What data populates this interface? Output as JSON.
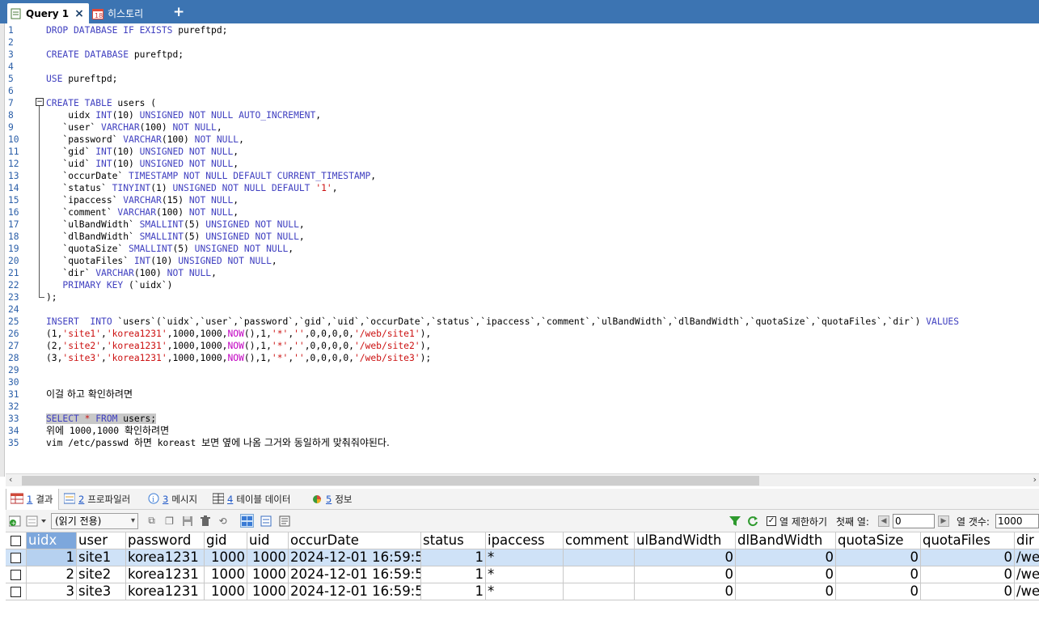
{
  "tabs": [
    {
      "label": "Query 1",
      "close": "×"
    },
    {
      "label": "히스토리"
    }
  ],
  "new_tab": "+",
  "editor": {
    "lines": [
      {
        "n": "1",
        "html": "<span class=\"kw\">DROP DATABASE IF EXISTS</span> pureftpd;"
      },
      {
        "n": "2",
        "html": ""
      },
      {
        "n": "3",
        "html": "<span class=\"kw\">CREATE DATABASE</span> pureftpd;"
      },
      {
        "n": "4",
        "html": ""
      },
      {
        "n": "5",
        "html": "<span class=\"kw\">USE</span> pureftpd;"
      },
      {
        "n": "6",
        "html": ""
      },
      {
        "n": "7",
        "html": "<span class=\"kw\">CREATE TABLE</span> users ("
      },
      {
        "n": "8",
        "html": "    uidx <span class=\"kw\">INT</span>(10) <span class=\"kw\">UNSIGNED NOT NULL AUTO_INCREMENT</span>,"
      },
      {
        "n": "9",
        "html": "   `user` <span class=\"kw\">VARCHAR</span>(100) <span class=\"kw\">NOT NULL</span>,"
      },
      {
        "n": "10",
        "html": "   `password` <span class=\"kw\">VARCHAR</span>(100) <span class=\"kw\">NOT NULL</span>,"
      },
      {
        "n": "11",
        "html": "   `gid` <span class=\"kw\">INT</span>(10) <span class=\"kw\">UNSIGNED NOT NULL</span>,"
      },
      {
        "n": "12",
        "html": "   `uid` <span class=\"kw\">INT</span>(10) <span class=\"kw\">UNSIGNED NOT NULL</span>,"
      },
      {
        "n": "13",
        "html": "   `occurDate` <span class=\"kw\">TIMESTAMP NOT NULL DEFAULT CURRENT_TIMESTAMP</span>,"
      },
      {
        "n": "14",
        "html": "   `status` <span class=\"kw\">TINYINT</span>(1) <span class=\"kw\">UNSIGNED NOT NULL DEFAULT</span> <span class=\"str\">'1'</span>,"
      },
      {
        "n": "15",
        "html": "   `ipaccess` <span class=\"kw\">VARCHAR</span>(15) <span class=\"kw\">NOT NULL</span>,"
      },
      {
        "n": "16",
        "html": "   `comment` <span class=\"kw\">VARCHAR</span>(100) <span class=\"kw\">NOT NULL</span>,"
      },
      {
        "n": "17",
        "html": "   `ulBandWidth` <span class=\"kw\">SMALLINT</span>(5) <span class=\"kw\">UNSIGNED NOT NULL</span>,"
      },
      {
        "n": "18",
        "html": "   `dlBandWidth` <span class=\"kw\">SMALLINT</span>(5) <span class=\"kw\">UNSIGNED NOT NULL</span>,"
      },
      {
        "n": "19",
        "html": "   `quotaSize` <span class=\"kw\">SMALLINT</span>(5) <span class=\"kw\">UNSIGNED NOT NULL</span>,"
      },
      {
        "n": "20",
        "html": "   `quotaFiles` <span class=\"kw\">INT</span>(10) <span class=\"kw\">UNSIGNED NOT NULL</span>,"
      },
      {
        "n": "21",
        "html": "   `dir` <span class=\"kw\">VARCHAR</span>(100) <span class=\"kw\">NOT NULL</span>,"
      },
      {
        "n": "22",
        "html": "   <span class=\"kw\">PRIMARY KEY</span> (`uidx`)"
      },
      {
        "n": "23",
        "html": ");"
      },
      {
        "n": "24",
        "html": ""
      },
      {
        "n": "25",
        "html": "<span class=\"kw\">INSERT  INTO</span> `users`(`uidx`,`user`,`password`,`gid`,`uid`,`occurDate`,`status`,`ipaccess`,`comment`,`ulBandWidth`,`dlBandWidth`,`quotaSize`,`quotaFiles`,`dir`) <span class=\"kw\">VALUES</span>"
      },
      {
        "n": "26",
        "html": "(1,<span class=\"str\">'site1'</span>,<span class=\"str\">'korea1231'</span>,1000,1000,<span class=\"fn\">NOW</span>(),1,<span class=\"str\">'*'</span>,<span class=\"str\">''</span>,0,0,0,0,<span class=\"str\">'/web/site1'</span>),"
      },
      {
        "n": "27",
        "html": "(2,<span class=\"str\">'site2'</span>,<span class=\"str\">'korea1231'</span>,1000,1000,<span class=\"fn\">NOW</span>(),1,<span class=\"str\">'*'</span>,<span class=\"str\">''</span>,0,0,0,0,<span class=\"str\">'/web/site2'</span>),"
      },
      {
        "n": "28",
        "html": "(3,<span class=\"str\">'site3'</span>,<span class=\"str\">'korea1231'</span>,1000,1000,<span class=\"fn\">NOW</span>(),1,<span class=\"str\">'*'</span>,<span class=\"str\">''</span>,0,0,0,0,<span class=\"str\">'/web/site3'</span>);"
      },
      {
        "n": "29",
        "html": ""
      },
      {
        "n": "30",
        "html": ""
      },
      {
        "n": "31",
        "html": "<span class=\"ko\">이걸 하고 확인하려면</span>"
      },
      {
        "n": "32",
        "html": ""
      },
      {
        "n": "33",
        "html": "<span class=\"sel\"><span class=\"kw\">SELECT</span> <span class=\"str\">*</span> <span class=\"kw\">FROM</span> users;</span>"
      },
      {
        "n": "34",
        "html": "<span class=\"ko\">위에</span> 1000,1000 <span class=\"ko\">확인하려면</span>"
      },
      {
        "n": "35",
        "html": "vim /etc/passwd <span class=\"ko\">하면</span> koreast <span class=\"ko\">보면 옆에 나옴 그거와 동일하게 맞춰줘야된다.</span>"
      }
    ]
  },
  "result_tabs": [
    {
      "num": "1",
      "label": "결과",
      "icon": "grid-icon"
    },
    {
      "num": "2",
      "label": "프로파일러",
      "icon": "profiler-icon"
    },
    {
      "num": "3",
      "label": "메시지",
      "icon": "info-icon"
    },
    {
      "num": "4",
      "label": "테이블 데이터",
      "icon": "table-icon"
    },
    {
      "num": "5",
      "label": "정보",
      "icon": "pie-icon"
    }
  ],
  "toolbar": {
    "mode_select": "(읽기 전용)",
    "limit_label": "열 제한하기",
    "first_row_label": "첫째 열:",
    "first_row_value": "0",
    "row_count_label": "열 갯수:",
    "row_count_value": "1000"
  },
  "grid": {
    "columns": [
      "uidx",
      "user",
      "password",
      "gid",
      "uid",
      "occurDate",
      "status",
      "ipaccess",
      "comment",
      "ulBandWidth",
      "dlBandWidth",
      "quotaSize",
      "quotaFiles",
      "dir"
    ],
    "rows": [
      [
        "1",
        "site1",
        "korea1231",
        "1000",
        "1000",
        "2024-12-01 16:59:5",
        "1",
        "*",
        "",
        "0",
        "0",
        "0",
        "0",
        "/web"
      ],
      [
        "2",
        "site2",
        "korea1231",
        "1000",
        "1000",
        "2024-12-01 16:59:5",
        "1",
        "*",
        "",
        "0",
        "0",
        "0",
        "0",
        "/web"
      ],
      [
        "3",
        "site3",
        "korea1231",
        "1000",
        "1000",
        "2024-12-01 16:59:5",
        "1",
        "*",
        "",
        "0",
        "0",
        "0",
        "0",
        "/web"
      ]
    ]
  }
}
